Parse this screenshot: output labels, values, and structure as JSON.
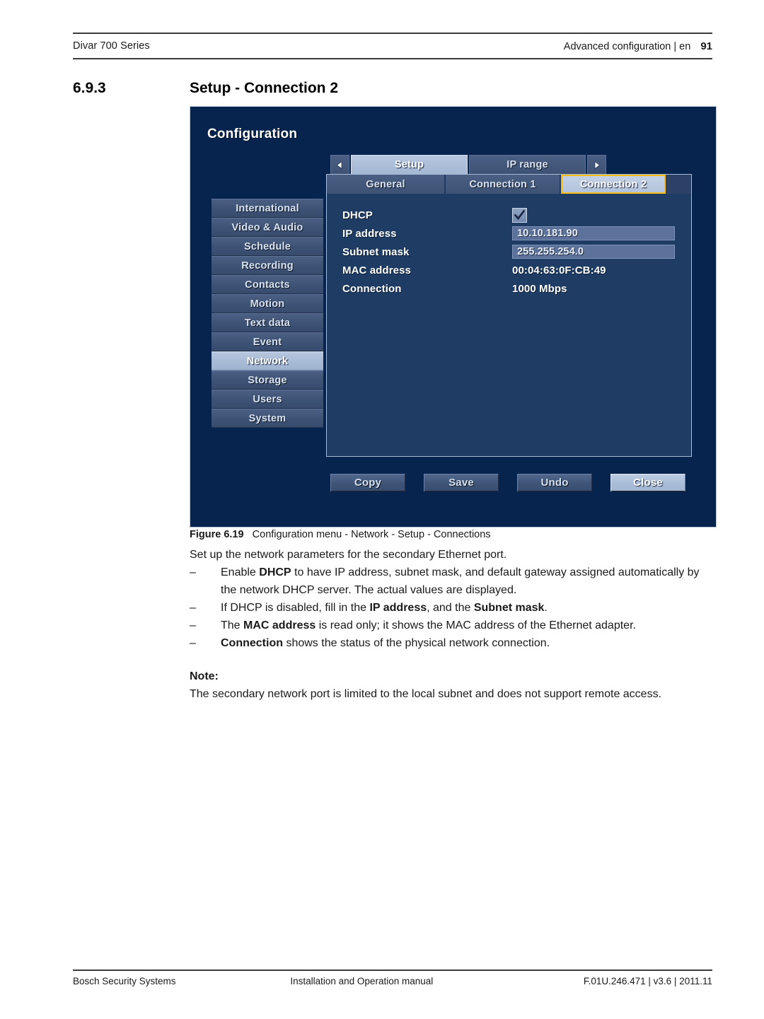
{
  "header": {
    "left": "Divar 700 Series",
    "right": "Advanced configuration | en",
    "page_number": "91"
  },
  "section": {
    "number": "6.9.3",
    "title": "Setup - Connection 2"
  },
  "screenshot": {
    "title": "Configuration",
    "sidebar": {
      "items": [
        {
          "label": "International",
          "selected": false
        },
        {
          "label": "Video & Audio",
          "selected": false
        },
        {
          "label": "Schedule",
          "selected": false
        },
        {
          "label": "Recording",
          "selected": false
        },
        {
          "label": "Contacts",
          "selected": false
        },
        {
          "label": "Motion",
          "selected": false
        },
        {
          "label": "Text data",
          "selected": false
        },
        {
          "label": "Event",
          "selected": false
        },
        {
          "label": "Network",
          "selected": true
        },
        {
          "label": "Storage",
          "selected": false
        },
        {
          "label": "Users",
          "selected": false
        },
        {
          "label": "System",
          "selected": false
        }
      ]
    },
    "top_tabs": {
      "prev_arrow": "left-arrow-icon",
      "next_arrow": "right-arrow-icon",
      "items": [
        {
          "label": "Setup",
          "active": true
        },
        {
          "label": "IP range",
          "active": false
        }
      ]
    },
    "sub_tabs": [
      {
        "label": "General",
        "active": false
      },
      {
        "label": "Connection 1",
        "active": false
      },
      {
        "label": "Connection 2",
        "active": true
      }
    ],
    "form": {
      "dhcp": {
        "label": "DHCP",
        "checked": true
      },
      "ip_address": {
        "label": "IP address",
        "value": "10.10.181.90"
      },
      "subnet_mask": {
        "label": "Subnet mask",
        "value": "255.255.254.0"
      },
      "mac_address": {
        "label": "MAC address",
        "value": "00:04:63:0F:CB:49"
      },
      "connection": {
        "label": "Connection",
        "value": "1000 Mbps"
      }
    },
    "buttons": [
      {
        "label": "Copy",
        "primary": false
      },
      {
        "label": "Save",
        "primary": false
      },
      {
        "label": "Undo",
        "primary": false
      },
      {
        "label": "Close",
        "primary": true
      }
    ],
    "colors": {
      "panel_background": "#07244f",
      "dialog_background": "#1e3c64",
      "tab_inactive": "#3d5275",
      "tab_active": "#b2c3dc",
      "highlight_border": "#f7bd16",
      "field_background": "#5c729a"
    }
  },
  "figure": {
    "label": "Figure",
    "number": "6.19",
    "caption": "Configuration menu - Network - Setup - Connections"
  },
  "body": {
    "lead": "Set up the network parameters for the secondary Ethernet port.",
    "bullets": [
      {
        "dash": "–",
        "parts": [
          {
            "text": "Enable ",
            "bold": false
          },
          {
            "text": "DHCP",
            "bold": true
          },
          {
            "text": " to have IP address, subnet mask, and default gateway assigned automatically by the network DHCP server. The actual values are displayed.",
            "bold": false
          }
        ]
      },
      {
        "dash": "–",
        "parts": [
          {
            "text": "If DHCP is disabled, fill in the ",
            "bold": false
          },
          {
            "text": "IP address",
            "bold": true
          },
          {
            "text": ", and the ",
            "bold": false
          },
          {
            "text": "Subnet mask",
            "bold": true
          },
          {
            "text": ".",
            "bold": false
          }
        ]
      },
      {
        "dash": "–",
        "parts": [
          {
            "text": "The ",
            "bold": false
          },
          {
            "text": "MAC address",
            "bold": true
          },
          {
            "text": " is read only; it shows the MAC address of the Ethernet adapter.",
            "bold": false
          }
        ]
      },
      {
        "dash": "–",
        "parts": [
          {
            "text": "Connection",
            "bold": true
          },
          {
            "text": " shows the status of the physical network connection.",
            "bold": false
          }
        ]
      }
    ],
    "note_heading": "Note:",
    "note_text": "The secondary network port is limited to the local subnet and does not support remote access."
  },
  "footer": {
    "left": "Bosch Security Systems",
    "middle": "Installation and Operation manual",
    "right": "F.01U.246.471 | v3.6 | 2011.11"
  }
}
